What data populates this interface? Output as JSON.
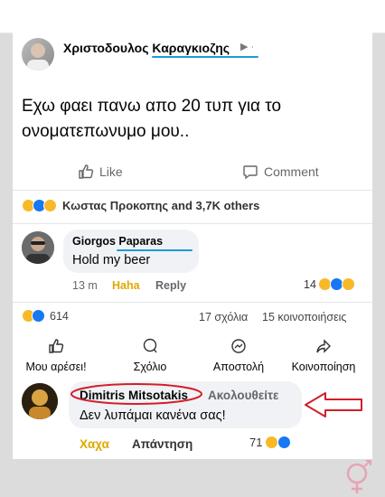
{
  "post": {
    "author": "Χριστοδουλος Καραγκιοζης",
    "author_suffix": "▶ ·",
    "text": "Εχω φαει πανω απο 20 τυπ για το ονοματεπωνυμο μου..",
    "like_label": "Like",
    "comment_label": "Comment",
    "reactors": "Κωστας Προκοπης and 3,7K others"
  },
  "comment1": {
    "author": "Giorgos Paparas",
    "text": "Hold my beer",
    "time": "13 m",
    "haha": "Haha",
    "reply": "Reply",
    "count": "14"
  },
  "stats": {
    "reactions": "614",
    "comments": "17 σχόλια",
    "shares": "15 κοινοποιήσεις"
  },
  "actions": {
    "like": "Μου αρέσει!",
    "comment": "Σχόλιο",
    "send": "Αποστολή",
    "share": "Κοινοποίηση"
  },
  "comment2": {
    "author": "Dimitris Mitsotakis",
    "follow": "Ακολουθείτε",
    "text": "Δεν λυπάμαι κανένα σας!",
    "haha": "Χαχα",
    "reply": "Απάντηση",
    "count": "71"
  },
  "colors": {
    "accent": "#1877f2",
    "underline": "#1a9cd8",
    "circle": "#d11f2a",
    "arrow": "#d11f2a",
    "haha": "#f7b928"
  }
}
